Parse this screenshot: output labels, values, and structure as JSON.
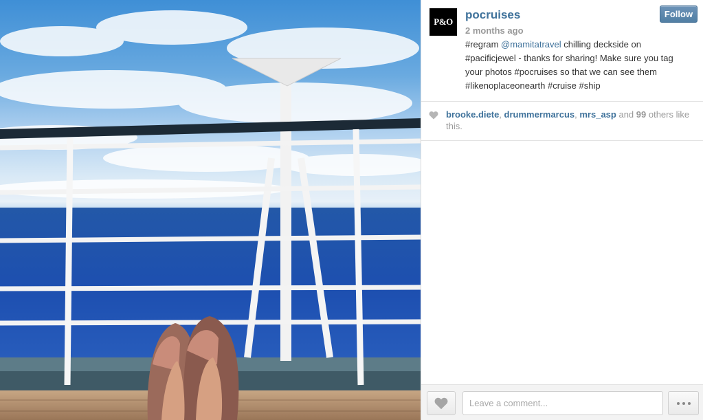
{
  "post": {
    "avatar_text": "P&O",
    "username": "pocruises",
    "time_ago": "2 months ago",
    "follow_label": "Follow",
    "caption_parts": {
      "part1": "#regram ",
      "mention": "@mamitatravel",
      "part2": " chilling deckside on #pacificjewel - thanks for sharing! Make sure you tag your photos #pocruises so that we can see them #likenoplaceonearth #cruise #ship"
    }
  },
  "likes": {
    "user1": "brooke.diete",
    "sep1": ", ",
    "user2": "drummermarcus",
    "sep2": ", ",
    "user3": "mrs_asp",
    "and_text": " and ",
    "count": "99",
    "others_text": " others like this."
  },
  "footer": {
    "comment_placeholder": "Leave a comment..."
  },
  "icons": {
    "like": "heart-icon",
    "more": "more-dots-icon"
  },
  "colors": {
    "link": "#3f729b",
    "follow_button": "#517fa4"
  }
}
